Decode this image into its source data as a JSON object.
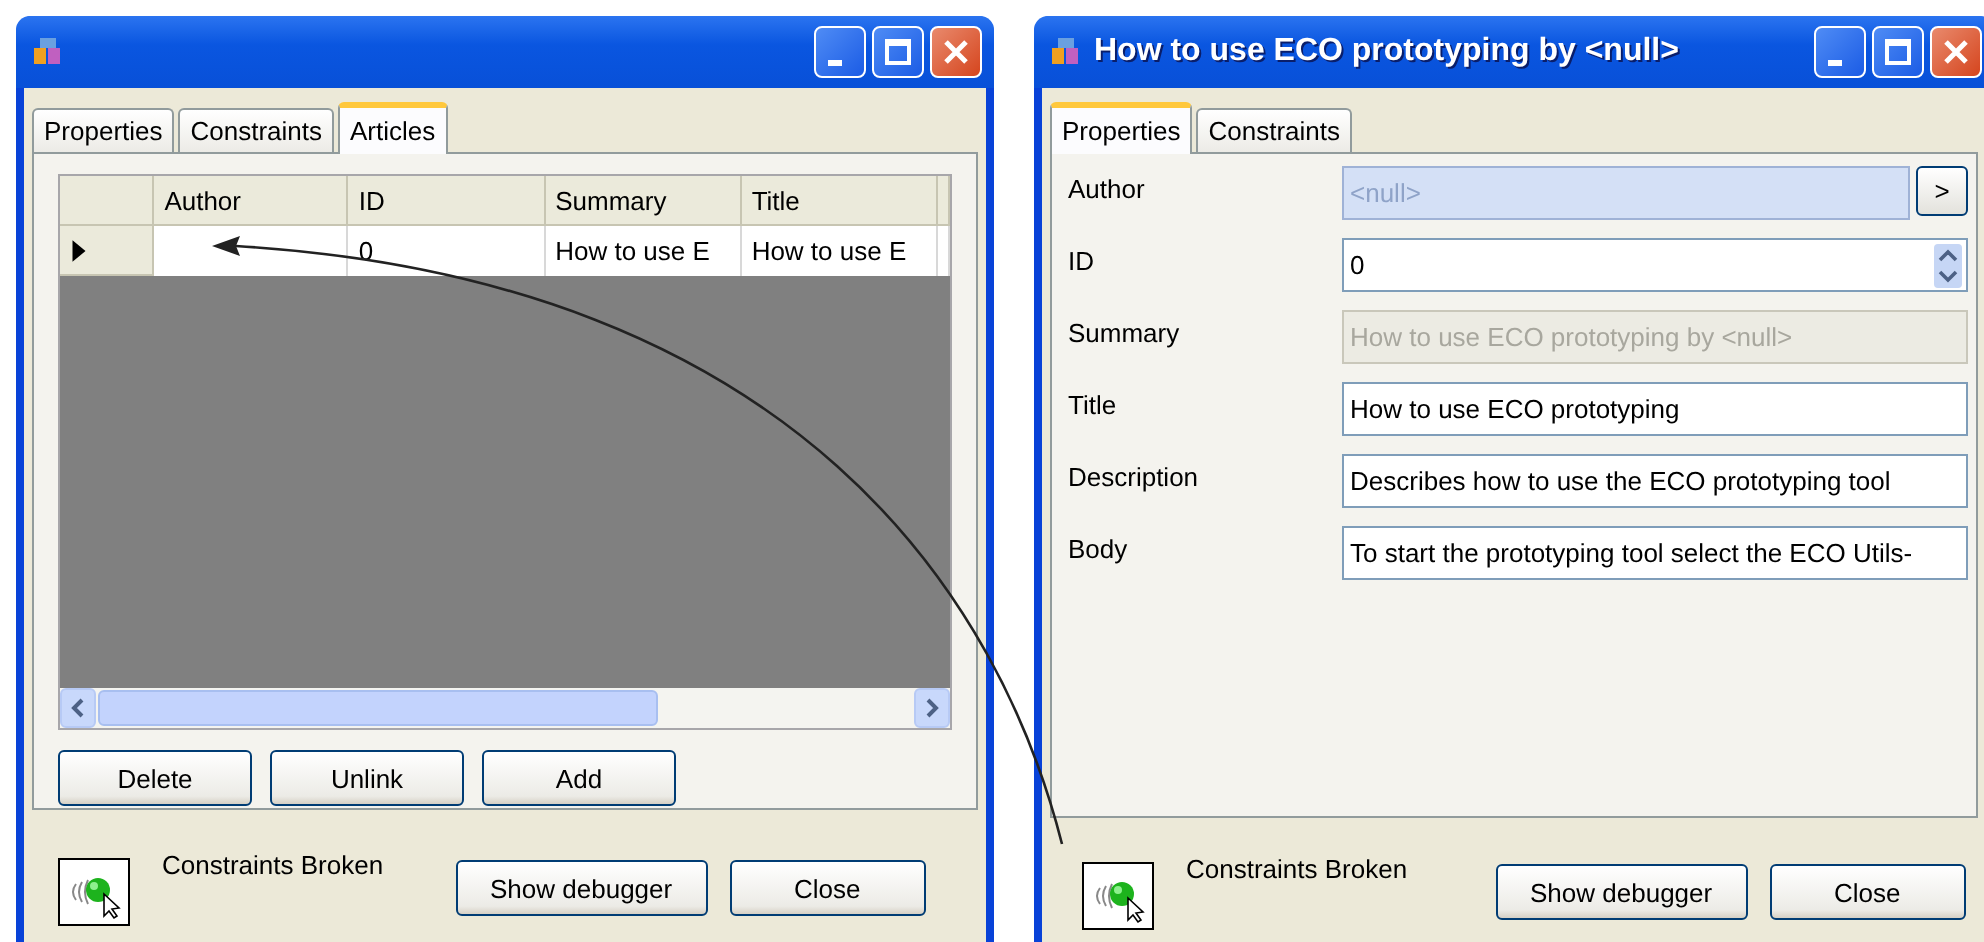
{
  "windows": [
    {
      "kind": "grid",
      "tabs": [
        {
          "label": "Properties",
          "selected": false
        },
        {
          "label": "Constraints",
          "selected": false
        },
        {
          "label": "Articles",
          "selected": true
        }
      ],
      "grid": {
        "columns": [
          "Author",
          "ID",
          "Summary",
          "Title"
        ],
        "rows": [
          {
            "current": true,
            "cells": [
              null,
              "0",
              "How to use E",
              "How to use E"
            ]
          }
        ]
      },
      "buttons": [
        "Delete",
        "Unlink",
        "Add"
      ],
      "status": "Constraints Broken",
      "footer_buttons": [
        "Show debugger",
        "Close"
      ]
    },
    {
      "kind": "form",
      "title": "How to use ECO prototyping by <null>",
      "tabs": [
        {
          "label": "Properties",
          "selected": true
        },
        {
          "label": "Constraints",
          "selected": false
        }
      ],
      "fields": [
        {
          "label": "Author",
          "kind": "link",
          "value": "<null>",
          "button": ">",
          "disabled": false
        },
        {
          "label": "ID",
          "kind": "spin",
          "value": "0",
          "disabled": false
        },
        {
          "label": "Summary",
          "kind": "text",
          "value": "How to use ECO prototyping by  <null>",
          "disabled": true
        },
        {
          "label": "Title",
          "kind": "text",
          "value": "How to use ECO prototyping",
          "disabled": false
        },
        {
          "label": "Description",
          "kind": "text",
          "value": "Describes how to use the ECO prototyping tool",
          "disabled": false
        },
        {
          "label": "Body",
          "kind": "text",
          "value": "To start the prototyping tool select the ECO Utils-",
          "disabled": false
        }
      ],
      "status": "Constraints Broken",
      "footer_buttons": [
        "Show debugger",
        "Close"
      ]
    }
  ]
}
